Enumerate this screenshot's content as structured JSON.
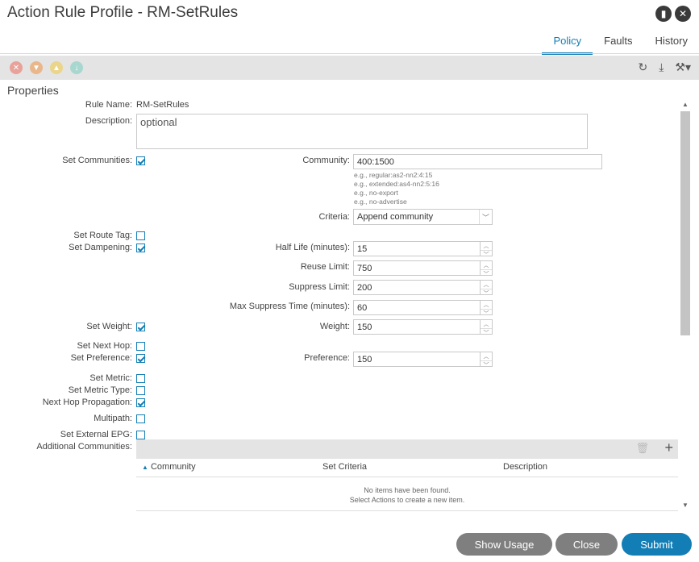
{
  "header": {
    "title": "Action Rule Profile - RM-SetRules",
    "tabs": [
      "Policy",
      "Faults",
      "History"
    ]
  },
  "toolbar": {
    "fault_icons": [
      {
        "name": "critical",
        "color": "#e8a29a",
        "glyph": "⊗"
      },
      {
        "name": "major",
        "color": "#e9b78a",
        "glyph": "▼"
      },
      {
        "name": "minor",
        "color": "#ead58a",
        "glyph": "▲"
      },
      {
        "name": "warning",
        "color": "#a8d7cf",
        "glyph": "⬇"
      }
    ]
  },
  "properties": {
    "heading": "Properties",
    "rule_name_label": "Rule Name:",
    "rule_name_value": "RM-SetRules",
    "description_label": "Description:",
    "description_placeholder": "optional",
    "set_communities_label": "Set Communities:",
    "community_label": "Community:",
    "community_value": "400:1500",
    "community_hints": [
      "e.g., regular:as2-nn2:4:15",
      "e.g., extended:as4-nn2:5:16",
      "e.g., no-export",
      "e.g., no-advertise"
    ],
    "criteria_label": "Criteria:",
    "criteria_value": "Append community",
    "set_route_tag_label": "Set Route Tag:",
    "set_dampening_label": "Set Dampening:",
    "half_life_label": "Half Life (minutes):",
    "half_life_value": "15",
    "reuse_limit_label": "Reuse Limit:",
    "reuse_limit_value": "750",
    "suppress_limit_label": "Suppress Limit:",
    "suppress_limit_value": "200",
    "max_suppress_label": "Max Suppress Time (minutes):",
    "max_suppress_value": "60",
    "set_weight_label": "Set Weight:",
    "weight_label": "Weight:",
    "weight_value": "150",
    "set_next_hop_label": "Set Next Hop:",
    "set_preference_label": "Set Preference:",
    "preference_label": "Preference:",
    "preference_value": "150",
    "set_metric_label": "Set Metric:",
    "set_metric_type_label": "Set Metric Type:",
    "next_hop_propagation_label": "Next Hop Propagation:",
    "multipath_label": "Multipath:",
    "set_external_epg_label": "Set External EPG:",
    "additional_communities_label": "Additional Communities:"
  },
  "table": {
    "columns": [
      "Community",
      "Set Criteria",
      "Description"
    ],
    "empty_line1": "No items have been found.",
    "empty_line2": "Select Actions to create a new item."
  },
  "buttons": {
    "show_usage": "Show Usage",
    "close": "Close",
    "submit": "Submit"
  }
}
